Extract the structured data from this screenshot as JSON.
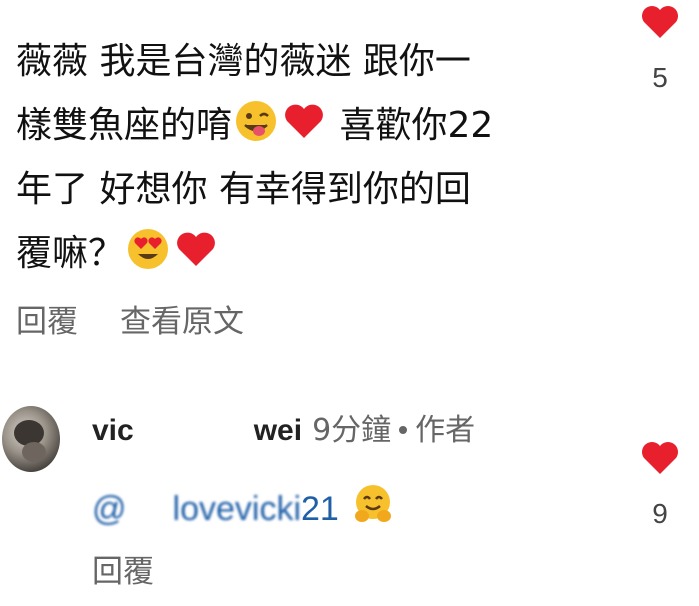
{
  "comment": {
    "lines": [
      "薇薇 我是台灣的薇迷 跟你一",
      "樣雙魚座的唷",
      "喜歡你22",
      "年了 好想你 有幸得到你的回",
      "覆嘛？"
    ],
    "likes": "5",
    "reply_label": "回覆",
    "translate_label": "查看原文"
  },
  "reply": {
    "username_start": "vic",
    "username_end": "wei",
    "time": "9分鐘",
    "author_badge": "作者",
    "mention_prefix": "@",
    "mention_visible": "lovevicki",
    "mention_tail": "21",
    "likes": "9",
    "reply_label": "回覆"
  },
  "icons": {
    "like": "heart-icon",
    "reaction_1": "tongue-wink-emoji",
    "reaction_2": "red-heart-emoji",
    "reaction_3": "heart-eyes-emoji",
    "reaction_4": "hugging-face-emoji"
  },
  "colors": {
    "heart": "#e8202e",
    "link": "#1f5fa8",
    "muted": "#666666"
  }
}
